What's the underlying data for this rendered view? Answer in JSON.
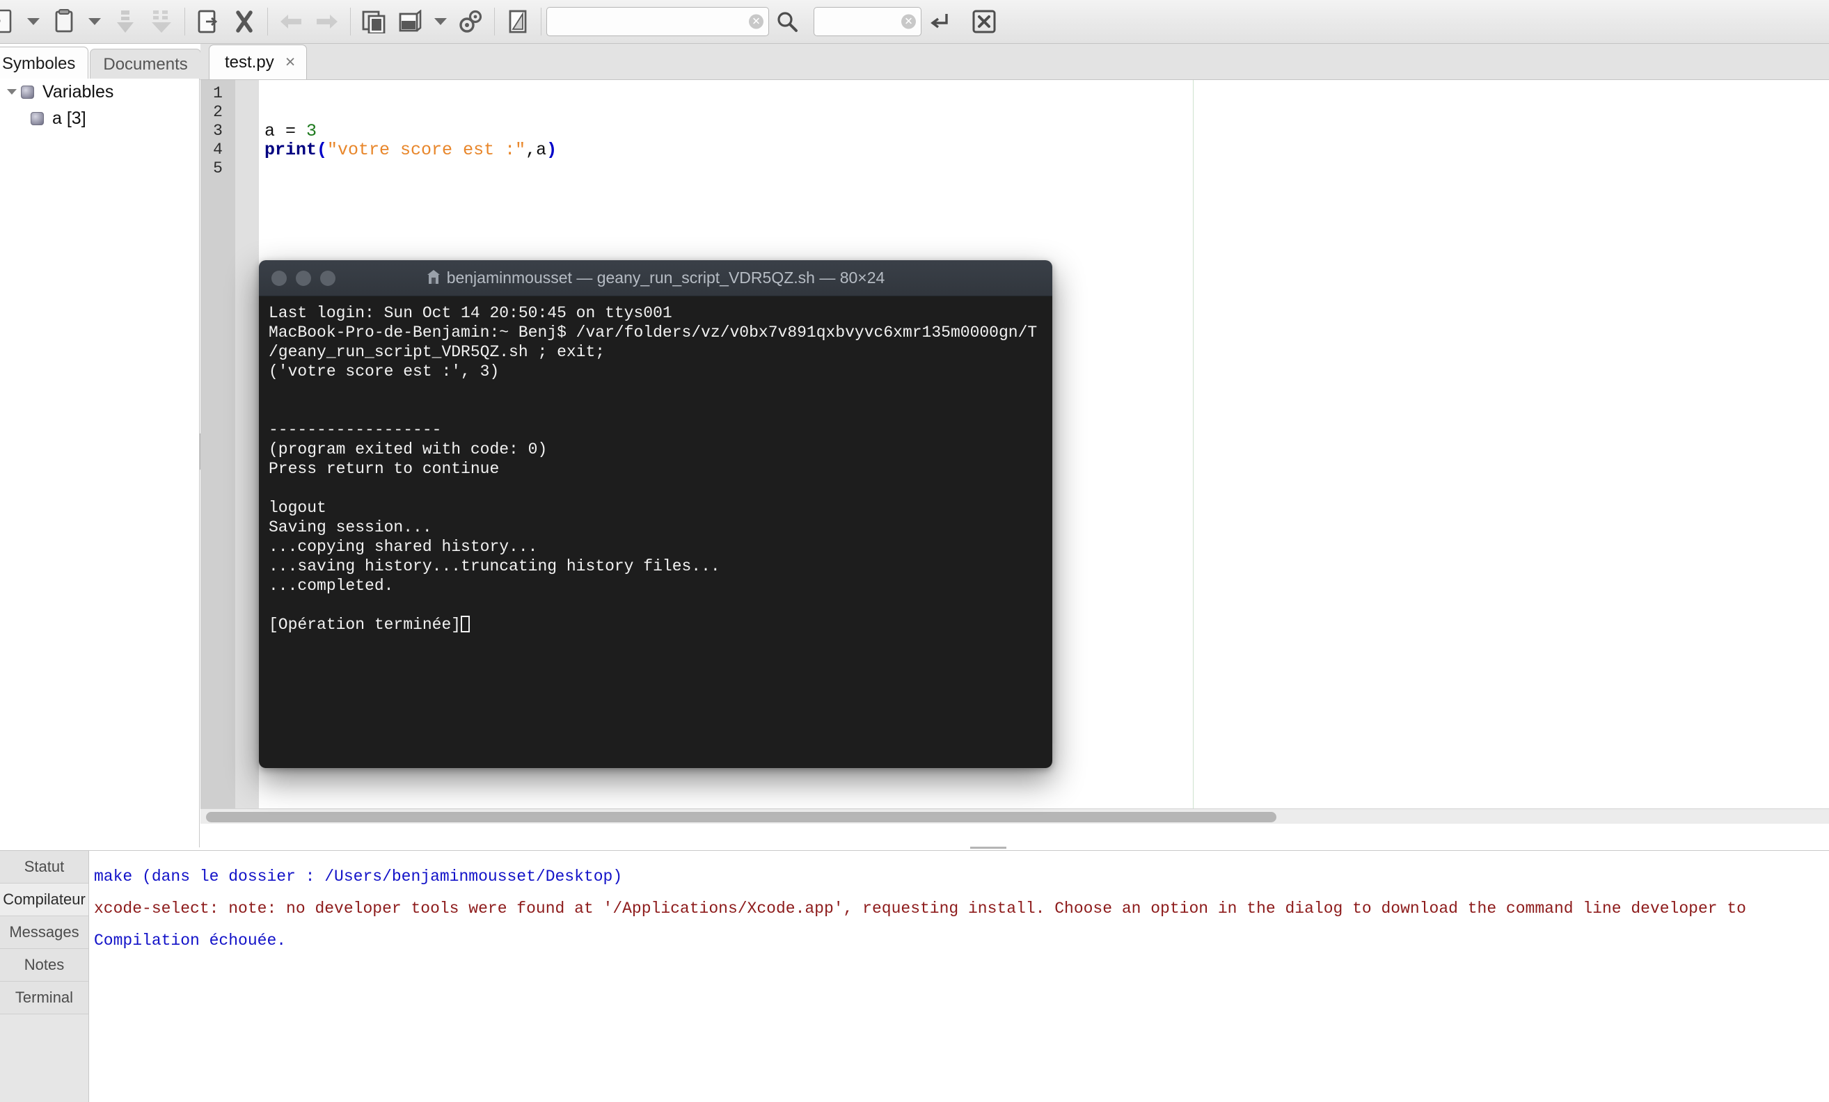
{
  "toolbar": {
    "buttons": [
      {
        "name": "new-document-icon",
        "label": "Nouveau"
      },
      {
        "name": "new-document-dropdown-icon",
        "label": "Nouveau (menu)"
      },
      {
        "name": "open-file-icon",
        "label": "Ouvrir"
      },
      {
        "name": "open-file-dropdown-icon",
        "label": "Ouvrir (menu)"
      },
      {
        "name": "save-icon",
        "label": "Enregistrer"
      },
      {
        "name": "save-all-icon",
        "label": "Tout enregistrer"
      },
      {
        "name": "reload-icon",
        "label": "Recharger"
      },
      {
        "name": "close-document-icon",
        "label": "Fermer"
      },
      {
        "name": "navigate-back-icon",
        "label": "Reculer"
      },
      {
        "name": "navigate-forward-icon",
        "label": "Avancer"
      },
      {
        "name": "compile-icon",
        "label": "Compiler"
      },
      {
        "name": "build-icon",
        "label": "Construire"
      },
      {
        "name": "build-dropdown-icon",
        "label": "Construire (menu)"
      },
      {
        "name": "run-icon",
        "label": "Exécuter"
      },
      {
        "name": "color-chooser-icon",
        "label": "Sélecteur de couleur"
      }
    ],
    "search_entry": {
      "value": "",
      "placeholder": ""
    },
    "goto_entry": {
      "value": "",
      "placeholder": ""
    },
    "search_button": "search-icon",
    "goto_button": "goto-line-icon",
    "quit_button": "quit-icon"
  },
  "sidebar": {
    "tabs": [
      {
        "label": "Symboles",
        "active": true
      },
      {
        "label": "Documents",
        "active": false
      }
    ],
    "tree": [
      {
        "label": "Variables",
        "icon": "symbol-namespace-icon",
        "level": 0,
        "expanded": true
      },
      {
        "label": "a [3]",
        "icon": "symbol-variable-icon",
        "level": 1,
        "expanded": false
      }
    ]
  },
  "editor": {
    "tabs": [
      {
        "label": "test.py",
        "close": "×",
        "active": true
      }
    ],
    "line_numbers": [
      "1",
      "2",
      "3",
      "4",
      "5"
    ],
    "code_lines": [
      {
        "tokens": [
          {
            "t": "",
            "c": "plain"
          }
        ]
      },
      {
        "tokens": [
          {
            "t": "",
            "c": "plain"
          }
        ]
      },
      {
        "tokens": [
          {
            "t": "a = ",
            "c": "plain"
          },
          {
            "t": "3",
            "c": "num"
          }
        ]
      },
      {
        "tokens": [
          {
            "t": "print",
            "c": "kw"
          },
          {
            "t": "(",
            "c": "op"
          },
          {
            "t": "\"votre score est :\"",
            "c": "str"
          },
          {
            "t": ",a",
            "c": "plain"
          },
          {
            "t": ")",
            "c": "op"
          }
        ]
      },
      {
        "tokens": [
          {
            "t": "",
            "c": "plain"
          }
        ]
      }
    ]
  },
  "terminal": {
    "title": "benjaminmousset — geany_run_script_VDR5QZ.sh — 80×24",
    "title_icon": "terminal-home-icon",
    "traffic_lights": [
      "close-button",
      "minimize-button",
      "zoom-button"
    ],
    "lines": [
      "Last login: Sun Oct 14 20:50:45 on ttys001",
      "MacBook-Pro-de-Benjamin:~ Benj$ /var/folders/vz/v0bx7v891qxbvyvc6xmr135m0000gn/T",
      "/geany_run_script_VDR5QZ.sh ; exit;",
      "('votre score est :', 3)",
      "",
      "",
      "------------------",
      "(program exited with code: 0)",
      "Press return to continue",
      "",
      "logout",
      "Saving session...",
      "...copying shared history...",
      "...saving history...truncating history files...",
      "...completed.",
      "",
      "[Opération terminée]"
    ]
  },
  "bottom_panel": {
    "tabs": [
      {
        "label": "Statut",
        "active": false
      },
      {
        "label": "Compilateur",
        "active": true
      },
      {
        "label": "Messages",
        "active": false
      },
      {
        "label": "Notes",
        "active": false
      },
      {
        "label": "Terminal",
        "active": false
      }
    ],
    "log_lines": [
      {
        "text": "make (dans le dossier : /Users/benjaminmousset/Desktop)",
        "color": "blue"
      },
      {
        "text": "xcode-select: note: no developer tools were found at '/Applications/Xcode.app', requesting install. Choose an option in the dialog to download the command line developer to",
        "color": "red"
      },
      {
        "text": "Compilation échouée.",
        "color": "blue"
      }
    ]
  },
  "colors": {
    "accent_blue": "#1212c8",
    "error_red": "#8d1b1b",
    "keyword_blue": "#000080",
    "string_orange": "#e8862a",
    "number_green": "#1e7a1e",
    "terminal_bg": "#1d1d1d",
    "terminal_titlebar": "#33383f",
    "chrome_grey": "#ececec"
  }
}
